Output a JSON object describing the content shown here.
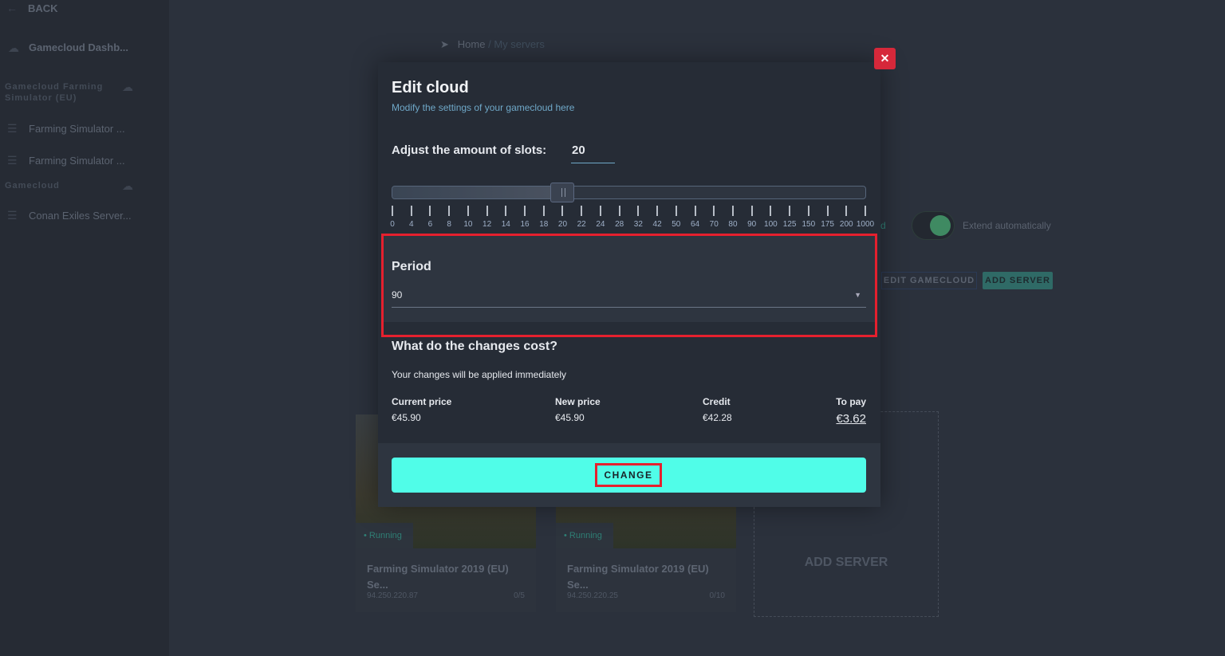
{
  "sidebar": {
    "back": "BACK",
    "dashboard": "Gamecloud Dashb...",
    "groups": [
      {
        "label": "Gamecloud Farming Simulator (EU)",
        "items": [
          "Farming Simulator ...",
          "Farming Simulator ..."
        ]
      },
      {
        "label": "Gamecloud",
        "items": [
          "Conan Exiles Server..."
        ]
      }
    ]
  },
  "breadcrumb": {
    "home": "Home",
    "sep": "/",
    "current": "My servers"
  },
  "page": {
    "extend_label": "Extend automatically",
    "extend_on": true,
    "edit_gamecloud": "EDIT GAMECLOUD",
    "add_server": "ADD SERVER",
    "d_fragment": "d",
    "cards": [
      {
        "status": "Running",
        "title": "Farming Simulator 2019 (EU) Se...",
        "ip": "94.250.220.87",
        "slots": "0/5"
      },
      {
        "status": "Running",
        "title": "Farming Simulator 2019 (EU) Se...",
        "ip": "94.250.220.25",
        "slots": "0/10"
      }
    ],
    "add_card": "ADD SERVER"
  },
  "modal": {
    "title": "Edit cloud",
    "subtitle": "Modify the settings of your gamecloud here",
    "slots_label": "Adjust the amount of slots:",
    "slots_value": "20",
    "slider_ticks": [
      "0",
      "4",
      "6",
      "8",
      "10",
      "12",
      "14",
      "16",
      "18",
      "20",
      "22",
      "24",
      "28",
      "32",
      "42",
      "50",
      "64",
      "70",
      "80",
      "90",
      "100",
      "125",
      "150",
      "175",
      "200",
      "1000"
    ],
    "slider_index": 9,
    "period_label": "Period",
    "period_value": "90",
    "cost_title": "What do the changes cost?",
    "cost_sub": "Your changes will be applied immediately",
    "current_price_label": "Current price",
    "current_price": "€45.90",
    "new_price_label": "New price",
    "new_price": "€45.90",
    "credit_label": "Credit",
    "credit": "€42.28",
    "to_pay_label": "To pay",
    "to_pay": "€3.62",
    "change_button": "CHANGE",
    "close": "✕"
  },
  "colors": {
    "accent": "#50fde8",
    "close": "#d6283a",
    "highlight": "#e5202e",
    "link": "#6fa8c8"
  }
}
